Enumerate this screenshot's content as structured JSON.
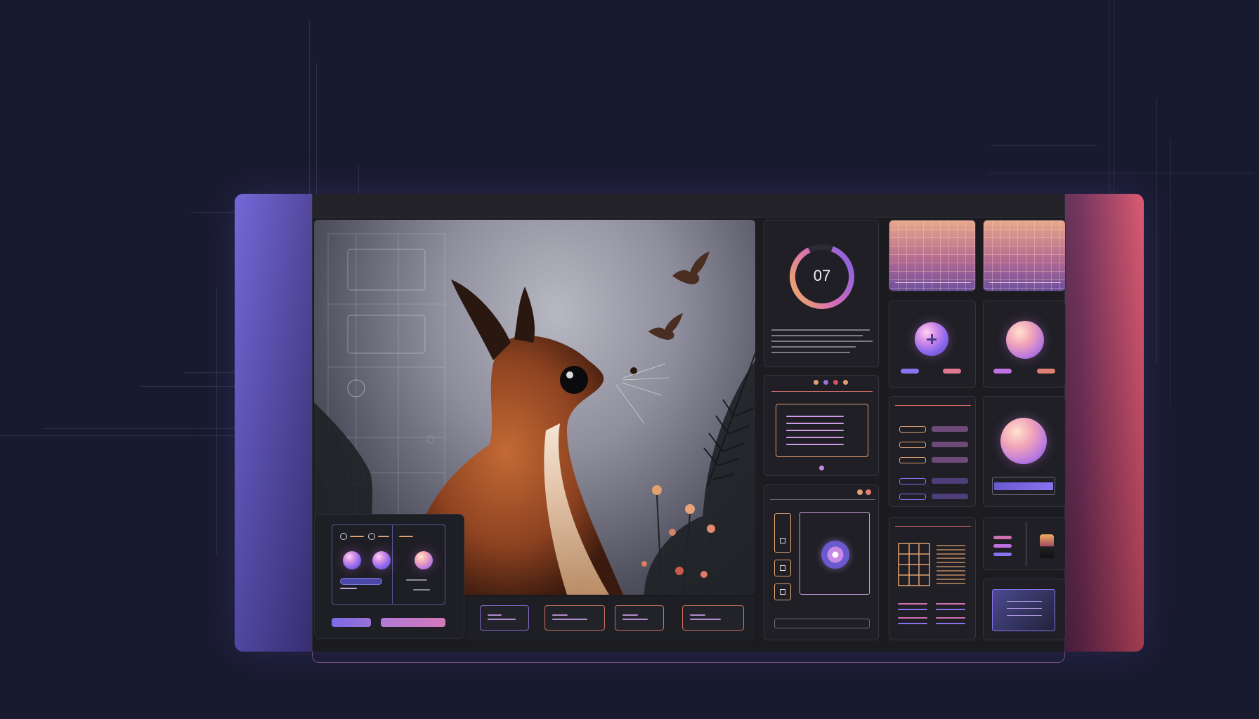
{
  "counter": {
    "value": "07"
  },
  "form": {
    "field_labels": [
      "",
      "",
      "",
      "",
      ""
    ],
    "input_value": ""
  },
  "colors": {
    "background": "#181a2e",
    "accent_purple": "#8e6af0",
    "accent_pink": "#d8506a",
    "accent_orange": "#e0a070",
    "panel": "#1f1f25"
  },
  "icons": {
    "plus": "plus-icon",
    "record": "record-icon",
    "square": "square-icon"
  }
}
